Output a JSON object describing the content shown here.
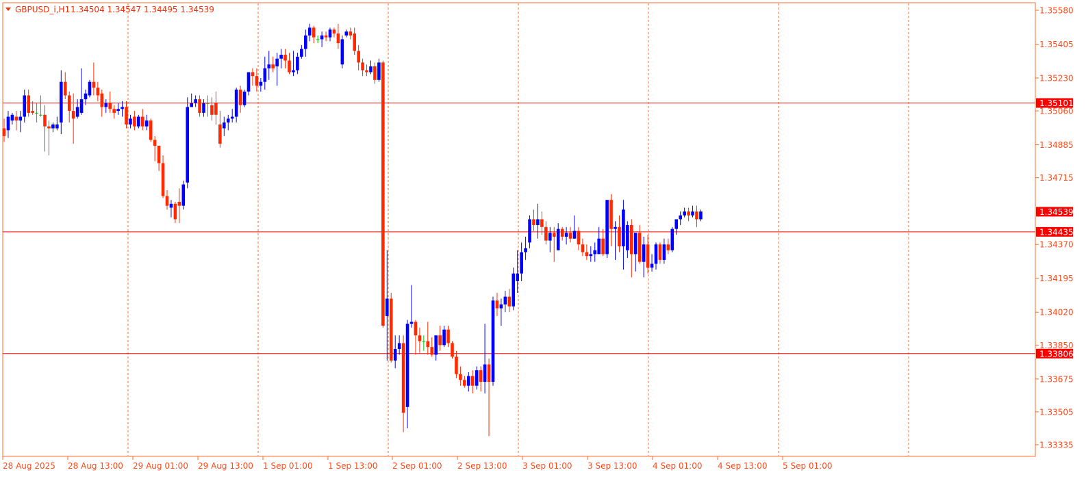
{
  "header": {
    "symbol_label": "GBPUSD_i,H1",
    "ohlc_label": "1.34504 1.34547 1.34495 1.34539"
  },
  "colors": {
    "bull": "#0000ff",
    "bear": "#ff2a00",
    "doji": "#00c000",
    "axis": "#ff6a2a",
    "grid": "#ff6a2a",
    "hline": "#ff0000",
    "label_bg": "#ff0000",
    "label_text": "#ffffff"
  },
  "chart_data": {
    "type": "candlestick",
    "timeframe": "H1",
    "grid": true,
    "y_ticks": [
      "1.35580",
      "1.35405",
      "1.35230",
      "1.35060",
      "1.34885",
      "1.34715",
      "1.34370",
      "1.34195",
      "1.34020",
      "1.33850",
      "1.33675",
      "1.33505",
      "1.33335"
    ],
    "x_ticks": [
      "28 Aug 2025",
      "28 Aug 13:00",
      "29 Aug 01:00",
      "29 Aug 13:00",
      "1 Sep 01:00",
      "1 Sep 13:00",
      "2 Sep 01:00",
      "2 Sep 13:00",
      "3 Sep 01:00",
      "3 Sep 13:00",
      "4 Sep 01:00",
      "4 Sep 13:00",
      "5 Sep 01:00"
    ],
    "ylim": [
      1.3327,
      1.3561
    ],
    "price_labels": [
      {
        "value": 1.35101,
        "text": "1.35101",
        "line": true
      },
      {
        "value": 1.34539,
        "text": "1.34539",
        "line": false
      },
      {
        "value": 1.34435,
        "text": "1.34435",
        "line": true
      },
      {
        "value": 1.33806,
        "text": "1.33806",
        "line": true
      }
    ],
    "candles": [
      [
        1.3497,
        1.3502,
        1.349,
        1.3493
      ],
      [
        1.3496,
        1.3506,
        1.3492,
        1.3503
      ],
      [
        1.3501,
        1.3505,
        1.3499,
        1.3504
      ],
      [
        1.3503,
        1.3506,
        1.3496,
        1.3501
      ],
      [
        1.3501,
        1.3506,
        1.3495,
        1.3503
      ],
      [
        1.3503,
        1.3517,
        1.35,
        1.3514
      ],
      [
        1.3514,
        1.3517,
        1.3503,
        1.3505
      ],
      [
        1.3506,
        1.3511,
        1.3504,
        1.3505
      ],
      [
        1.3505,
        1.351,
        1.35,
        1.3505
      ],
      [
        1.3504,
        1.3514,
        1.3503,
        1.3504
      ],
      [
        1.3504,
        1.3509,
        1.3485,
        1.3498
      ],
      [
        1.3498,
        1.3501,
        1.3483,
        1.3497
      ],
      [
        1.3497,
        1.35,
        1.3495,
        1.3499
      ],
      [
        1.3497,
        1.3503,
        1.3496,
        1.3499
      ],
      [
        1.35,
        1.3527,
        1.3494,
        1.3521
      ],
      [
        1.3521,
        1.3526,
        1.3512,
        1.3514
      ],
      [
        1.3514,
        1.3516,
        1.35,
        1.3506
      ],
      [
        1.3506,
        1.3515,
        1.3489,
        1.3502
      ],
      [
        1.3503,
        1.3512,
        1.3502,
        1.3508
      ],
      [
        1.3505,
        1.3528,
        1.3504,
        1.3512
      ],
      [
        1.3512,
        1.3517,
        1.3509,
        1.3515
      ],
      [
        1.3514,
        1.3522,
        1.3513,
        1.3521
      ],
      [
        1.3521,
        1.3531,
        1.3514,
        1.3518
      ],
      [
        1.3518,
        1.3521,
        1.3511,
        1.3514
      ],
      [
        1.3515,
        1.3517,
        1.3503,
        1.3508
      ],
      [
        1.3508,
        1.3512,
        1.3505,
        1.351
      ],
      [
        1.351,
        1.3516,
        1.3505,
        1.3507
      ],
      [
        1.3507,
        1.3509,
        1.3502,
        1.3505
      ],
      [
        1.3506,
        1.351,
        1.3504,
        1.3507
      ],
      [
        1.3507,
        1.3511,
        1.3503,
        1.3508
      ],
      [
        1.3508,
        1.3511,
        1.3497,
        1.3499
      ],
      [
        1.3499,
        1.3504,
        1.3497,
        1.3502
      ],
      [
        1.3503,
        1.3506,
        1.3496,
        1.3498
      ],
      [
        1.3498,
        1.3504,
        1.3497,
        1.3503
      ],
      [
        1.3503,
        1.3507,
        1.3496,
        1.3498
      ],
      [
        1.3498,
        1.3504,
        1.3496,
        1.3501
      ],
      [
        1.3501,
        1.3502,
        1.349,
        1.3491
      ],
      [
        1.3491,
        1.3493,
        1.348,
        1.3488
      ],
      [
        1.3488,
        1.3487,
        1.3475,
        1.3479
      ],
      [
        1.3479,
        1.3483,
        1.3461,
        1.3462
      ],
      [
        1.3462,
        1.3465,
        1.3455,
        1.3457
      ],
      [
        1.3456,
        1.346,
        1.3451,
        1.3458
      ],
      [
        1.3458,
        1.3459,
        1.3448,
        1.345
      ],
      [
        1.3459,
        1.3466,
        1.3448,
        1.3457
      ],
      [
        1.3457,
        1.347,
        1.3455,
        1.3468
      ],
      [
        1.3469,
        1.3513,
        1.3466,
        1.3508
      ],
      [
        1.3508,
        1.3515,
        1.3508,
        1.351
      ],
      [
        1.351,
        1.3514,
        1.3508,
        1.3512
      ],
      [
        1.3512,
        1.3514,
        1.3503,
        1.3505
      ],
      [
        1.3505,
        1.3512,
        1.3503,
        1.351
      ],
      [
        1.351,
        1.3514,
        1.3503,
        1.351
      ],
      [
        1.3509,
        1.3513,
        1.3501,
        1.3504
      ],
      [
        1.351,
        1.3516,
        1.3499,
        1.3504
      ],
      [
        1.3499,
        1.3506,
        1.3487,
        1.3489
      ],
      [
        1.3497,
        1.3503,
        1.3493,
        1.35
      ],
      [
        1.35,
        1.3504,
        1.3496,
        1.3502
      ],
      [
        1.3502,
        1.3507,
        1.35,
        1.3503
      ],
      [
        1.3503,
        1.3518,
        1.35,
        1.3517
      ],
      [
        1.3517,
        1.3519,
        1.3505,
        1.3509
      ],
      [
        1.3509,
        1.3517,
        1.3508,
        1.3516
      ],
      [
        1.3516,
        1.3525,
        1.3514,
        1.3526
      ],
      [
        1.3526,
        1.3528,
        1.3519,
        1.3524
      ],
      [
        1.3524,
        1.3528,
        1.3516,
        1.3519
      ],
      [
        1.3519,
        1.3523,
        1.3516,
        1.3521
      ],
      [
        1.3521,
        1.3534,
        1.3517,
        1.3528
      ],
      [
        1.3528,
        1.3537,
        1.3522,
        1.353
      ],
      [
        1.353,
        1.3534,
        1.3526,
        1.3528
      ],
      [
        1.3529,
        1.3536,
        1.3519,
        1.3533
      ],
      [
        1.3533,
        1.3538,
        1.3528,
        1.3535
      ],
      [
        1.3535,
        1.3538,
        1.3528,
        1.3532
      ],
      [
        1.3532,
        1.3536,
        1.3525,
        1.3526
      ],
      [
        1.3526,
        1.3537,
        1.3524,
        1.3527
      ],
      [
        1.3527,
        1.3536,
        1.3525,
        1.3534
      ],
      [
        1.3534,
        1.354,
        1.3533,
        1.3538
      ],
      [
        1.3538,
        1.3548,
        1.3534,
        1.3545
      ],
      [
        1.3545,
        1.3551,
        1.3542,
        1.3549
      ],
      [
        1.3549,
        1.355,
        1.3541,
        1.3544
      ],
      [
        1.3543,
        1.3545,
        1.3541,
        1.3543
      ],
      [
        1.3543,
        1.3547,
        1.3539,
        1.3545
      ],
      [
        1.3545,
        1.3547,
        1.3542,
        1.3544
      ],
      [
        1.3544,
        1.3549,
        1.3542,
        1.3548
      ],
      [
        1.3548,
        1.3549,
        1.3544,
        1.3546
      ],
      [
        1.3546,
        1.3551,
        1.3538,
        1.3541
      ],
      [
        1.353,
        1.3545,
        1.3528,
        1.3543
      ],
      [
        1.3545,
        1.3548,
        1.3544,
        1.3547
      ],
      [
        1.3547,
        1.3549,
        1.3543,
        1.3545
      ],
      [
        1.3546,
        1.3549,
        1.3535,
        1.3537
      ],
      [
        1.3537,
        1.354,
        1.3527,
        1.3531
      ],
      [
        1.3531,
        1.3533,
        1.3524,
        1.3527
      ],
      [
        1.3527,
        1.353,
        1.3524,
        1.3526
      ],
      [
        1.3526,
        1.3532,
        1.3525,
        1.3529
      ],
      [
        1.3529,
        1.3531,
        1.352,
        1.3522
      ],
      [
        1.3522,
        1.3533,
        1.3521,
        1.3531
      ],
      [
        1.3531,
        1.3532,
        1.3394,
        1.3395
      ],
      [
        1.34,
        1.3434,
        1.3377,
        1.3409
      ],
      [
        1.3409,
        1.3412,
        1.3376,
        1.3377
      ],
      [
        1.3377,
        1.339,
        1.3373,
        1.3383
      ],
      [
        1.3383,
        1.339,
        1.338,
        1.3386
      ],
      [
        1.3386,
        1.339,
        1.334,
        1.335
      ],
      [
        1.3353,
        1.3398,
        1.3342,
        1.3396
      ],
      [
        1.3396,
        1.3416,
        1.3394,
        1.3397
      ],
      [
        1.3397,
        1.3398,
        1.338,
        1.339
      ],
      [
        1.339,
        1.3394,
        1.3381,
        1.3387
      ],
      [
        1.3387,
        1.339,
        1.3382,
        1.3387
      ],
      [
        1.3387,
        1.3397,
        1.338,
        1.3384
      ],
      [
        1.3384,
        1.3389,
        1.3379,
        1.338
      ],
      [
        1.338,
        1.3387,
        1.3377,
        1.339
      ],
      [
        1.339,
        1.3395,
        1.3382,
        1.3385
      ],
      [
        1.3385,
        1.3395,
        1.3384,
        1.3393
      ],
      [
        1.3393,
        1.3395,
        1.3384,
        1.3386
      ],
      [
        1.3386,
        1.3387,
        1.3378,
        1.3379
      ],
      [
        1.3379,
        1.3382,
        1.3368,
        1.337
      ],
      [
        1.337,
        1.3374,
        1.3364,
        1.3367
      ],
      [
        1.3367,
        1.3369,
        1.3363,
        1.3364
      ],
      [
        1.3364,
        1.3371,
        1.3361,
        1.3369
      ],
      [
        1.3369,
        1.3372,
        1.336,
        1.3364
      ],
      [
        1.3364,
        1.3374,
        1.3362,
        1.3372
      ],
      [
        1.3372,
        1.3374,
        1.3361,
        1.3366
      ],
      [
        1.3366,
        1.3396,
        1.336,
        1.3375
      ],
      [
        1.3375,
        1.3378,
        1.3338,
        1.3366
      ],
      [
        1.3366,
        1.341,
        1.3364,
        1.3408
      ],
      [
        1.3408,
        1.3412,
        1.34,
        1.3404
      ],
      [
        1.3404,
        1.3409,
        1.3395,
        1.3406
      ],
      [
        1.3406,
        1.3413,
        1.3402,
        1.341
      ],
      [
        1.341,
        1.3414,
        1.3402,
        1.3405
      ],
      [
        1.3405,
        1.3425,
        1.3403,
        1.3422
      ],
      [
        1.3418,
        1.3434,
        1.3412,
        1.3422
      ],
      [
        1.3422,
        1.3438,
        1.3418,
        1.3433
      ],
      [
        1.3433,
        1.3441,
        1.3429,
        1.3435
      ],
      [
        1.3438,
        1.3452,
        1.3435,
        1.345
      ],
      [
        1.345,
        1.3455,
        1.3444,
        1.3447
      ],
      [
        1.3447,
        1.3458,
        1.344,
        1.345
      ],
      [
        1.345,
        1.3454,
        1.3442,
        1.3446
      ],
      [
        1.3446,
        1.3449,
        1.3437,
        1.3439
      ],
      [
        1.3439,
        1.3446,
        1.3433,
        1.3443
      ],
      [
        1.3443,
        1.3446,
        1.3428,
        1.3441
      ],
      [
        1.3434,
        1.3448,
        1.3434,
        1.3445
      ],
      [
        1.3445,
        1.3446,
        1.3439,
        1.3441
      ],
      [
        1.3441,
        1.3446,
        1.3437,
        1.3443
      ],
      [
        1.3443,
        1.3446,
        1.3438,
        1.344
      ],
      [
        1.344,
        1.3452,
        1.344,
        1.3444
      ],
      [
        1.3444,
        1.3446,
        1.3434,
        1.3437
      ],
      [
        1.3437,
        1.344,
        1.3431,
        1.3433
      ],
      [
        1.3433,
        1.3437,
        1.3429,
        1.3431
      ],
      [
        1.3431,
        1.3436,
        1.3428,
        1.3432
      ],
      [
        1.3432,
        1.3438,
        1.3428,
        1.3434
      ],
      [
        1.3432,
        1.3446,
        1.3432,
        1.344
      ],
      [
        1.344,
        1.3445,
        1.3431,
        1.3432
      ],
      [
        1.3432,
        1.346,
        1.343,
        1.346
      ],
      [
        1.346,
        1.3463,
        1.3436,
        1.3445
      ],
      [
        1.3445,
        1.3449,
        1.3429,
        1.3446
      ],
      [
        1.3446,
        1.3452,
        1.3433,
        1.3436
      ],
      [
        1.3436,
        1.346,
        1.3424,
        1.3455
      ],
      [
        1.3434,
        1.3449,
        1.343,
        1.3447
      ],
      [
        1.3447,
        1.345,
        1.342,
        1.3432
      ],
      [
        1.3432,
        1.3443,
        1.3423,
        1.3443
      ],
      [
        1.3443,
        1.3447,
        1.3427,
        1.3428
      ],
      [
        1.3428,
        1.3441,
        1.342,
        1.3437
      ],
      [
        1.3437,
        1.3442,
        1.3422,
        1.3425
      ],
      [
        1.3425,
        1.3432,
        1.3423,
        1.3427
      ],
      [
        1.3427,
        1.3438,
        1.3424,
        1.3437
      ],
      [
        1.3437,
        1.3438,
        1.3427,
        1.3429
      ],
      [
        1.3429,
        1.344,
        1.3427,
        1.3437
      ],
      [
        1.3437,
        1.344,
        1.3432,
        1.3434
      ],
      [
        1.3434,
        1.3446,
        1.3433,
        1.3445
      ],
      [
        1.3445,
        1.345,
        1.3442,
        1.345
      ],
      [
        1.345,
        1.3454,
        1.3447,
        1.3452
      ],
      [
        1.3452,
        1.3456,
        1.3451,
        1.3454
      ],
      [
        1.3454,
        1.3456,
        1.3449,
        1.3452
      ],
      [
        1.3452,
        1.3457,
        1.3451,
        1.3454
      ],
      [
        1.3454,
        1.3457,
        1.3446,
        1.345
      ],
      [
        1.345,
        1.3455,
        1.3449,
        1.3454
      ]
    ]
  }
}
